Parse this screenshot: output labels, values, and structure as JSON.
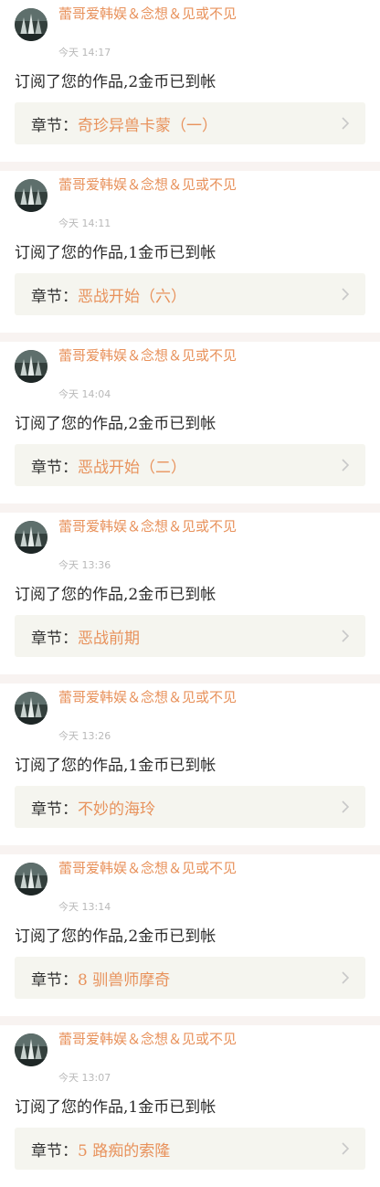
{
  "feed": {
    "items": [
      {
        "user": "蕾哥爱韩娱＆念想＆见或不见",
        "time": "今天 14:17",
        "message": "订阅了您的作品,2金币已到帐",
        "chapter_label": "章节：",
        "chapter_title": "奇珍异兽卡蒙（一）"
      },
      {
        "user": "蕾哥爱韩娱＆念想＆见或不见",
        "time": "今天 14:11",
        "message": "订阅了您的作品,1金币已到帐",
        "chapter_label": "章节：",
        "chapter_title": "恶战开始（六）"
      },
      {
        "user": "蕾哥爱韩娱＆念想＆见或不见",
        "time": "今天 14:04",
        "message": "订阅了您的作品,2金币已到帐",
        "chapter_label": "章节：",
        "chapter_title": "恶战开始（二）"
      },
      {
        "user": "蕾哥爱韩娱＆念想＆见或不见",
        "time": "今天 13:36",
        "message": "订阅了您的作品,2金币已到帐",
        "chapter_label": "章节：",
        "chapter_title": "恶战前期"
      },
      {
        "user": "蕾哥爱韩娱＆念想＆见或不见",
        "time": "今天 13:26",
        "message": "订阅了您的作品,1金币已到帐",
        "chapter_label": "章节：",
        "chapter_title": "不妙的海玲"
      },
      {
        "user": "蕾哥爱韩娱＆念想＆见或不见",
        "time": "今天 13:14",
        "message": "订阅了您的作品,2金币已到帐",
        "chapter_label": "章节：",
        "chapter_title": "8 驯兽师摩奇"
      },
      {
        "user": "蕾哥爱韩娱＆念想＆见或不见",
        "time": "今天 13:07",
        "message": "订阅了您的作品,1金币已到帐",
        "chapter_label": "章节：",
        "chapter_title": "5 路痴的索隆"
      }
    ]
  },
  "colors": {
    "accent": "#e8925c",
    "separator": "#f8f3f1",
    "card": "#f5f5ef"
  }
}
